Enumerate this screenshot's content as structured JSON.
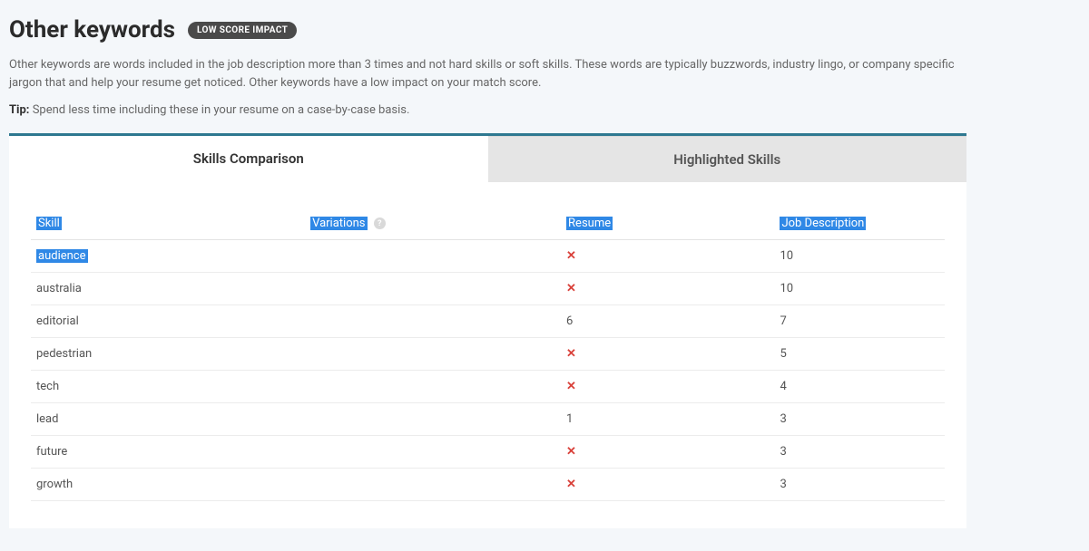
{
  "header": {
    "title": "Other keywords",
    "badge": "LOW SCORE IMPACT"
  },
  "description": "Other keywords are words included in the job description more than 3 times and not hard skills or soft skills. These words are typically buzzwords, industry lingo, or company specific jargon that and help your resume get noticed. Other keywords have a low impact on your match score.",
  "tip_label": "Tip:",
  "tip_text": " Spend less time including these in your resume on a case-by-case basis.",
  "tabs": {
    "skills_comparison": "Skills Comparison",
    "highlighted_skills": "Highlighted Skills"
  },
  "table": {
    "headers": {
      "skill": "Skill",
      "variations": "Variations",
      "resume": "Resume",
      "job_description": "Job Description"
    },
    "rows": [
      {
        "skill": "audience",
        "highlighted": true,
        "resume": null,
        "job": "10"
      },
      {
        "skill": "australia",
        "highlighted": false,
        "resume": null,
        "job": "10"
      },
      {
        "skill": "editorial",
        "highlighted": false,
        "resume": "6",
        "job": "7"
      },
      {
        "skill": "pedestrian",
        "highlighted": false,
        "resume": null,
        "job": "5"
      },
      {
        "skill": "tech",
        "highlighted": false,
        "resume": null,
        "job": "4"
      },
      {
        "skill": "lead",
        "highlighted": false,
        "resume": "1",
        "job": "3"
      },
      {
        "skill": "future",
        "highlighted": false,
        "resume": null,
        "job": "3"
      },
      {
        "skill": "growth",
        "highlighted": false,
        "resume": null,
        "job": "3"
      }
    ]
  },
  "icons": {
    "x": "✕",
    "info": "?"
  }
}
